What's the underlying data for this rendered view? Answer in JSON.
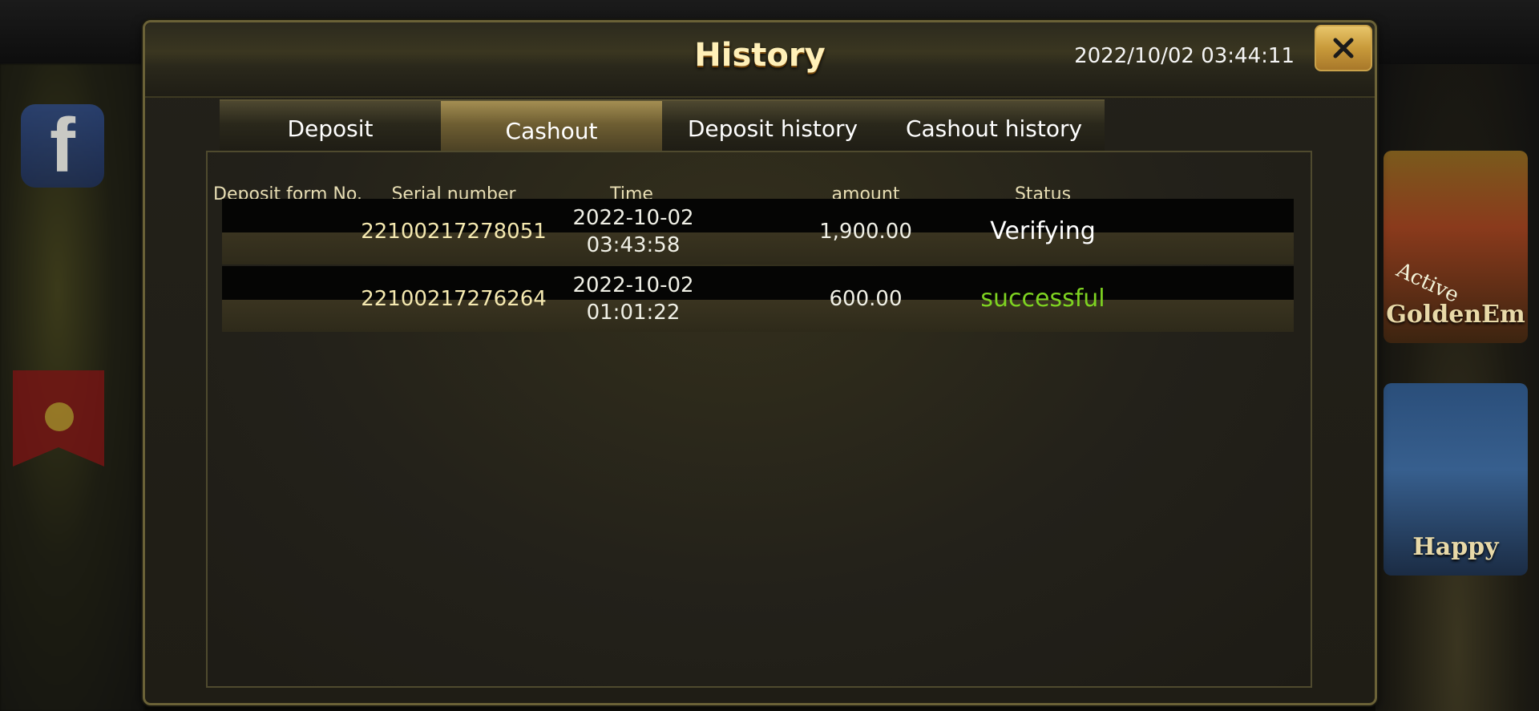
{
  "background": {
    "facebook_glyph": "f",
    "game_cards": [
      {
        "label": "GoldenEm",
        "badge": "Active"
      },
      {
        "label": "Happy"
      }
    ]
  },
  "dialog": {
    "title": "History",
    "datetime": "2022/10/02 03:44:11",
    "close_icon": "close-icon"
  },
  "tabs": [
    {
      "label": "Deposit",
      "active": false
    },
    {
      "label": "Cashout",
      "active": true
    },
    {
      "label": "Deposit history",
      "active": false
    },
    {
      "label": "Cashout history",
      "active": false
    }
  ],
  "table": {
    "columns": [
      "Deposit form No.",
      "Serial number",
      "Time",
      "amount",
      "Status"
    ],
    "rows": [
      {
        "deposit_form_no": "",
        "serial_number": "22100217278051",
        "date": "2022-10-02",
        "time": "03:43:58",
        "amount": "1,900.00",
        "status": "Verifying",
        "status_color": "#ffffff"
      },
      {
        "deposit_form_no": "",
        "serial_number": "22100217276264",
        "date": "2022-10-02",
        "time": "01:01:22",
        "amount": "600.00",
        "status": "successful",
        "status_color": "#7ed321"
      }
    ]
  },
  "colors": {
    "accent_gold": "#c89a3a",
    "title_text": "#fff0b8",
    "status_success": "#7ed321"
  }
}
